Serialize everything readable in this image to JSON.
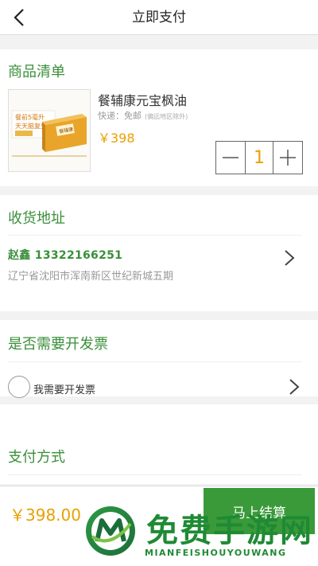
{
  "header": {
    "title": "立即支付",
    "back_icon": "chevron-left-icon"
  },
  "goods": {
    "section_title": "商品清单",
    "product": {
      "name": "餐辅康元宝枫油",
      "shipping": "快递：免邮",
      "shipping_note": "(偏远地区除外)",
      "price": "￥398",
      "image_text_line1": "餐前5毫升",
      "image_text_line2": "天天脑复生",
      "image_box_label": "餐辅康"
    },
    "quantity": "1"
  },
  "address": {
    "section_title": "收货地址",
    "name_phone": "赵鑫 13322166251",
    "detail": "辽宁省沈阳市浑南新区世纪新城五期"
  },
  "invoice": {
    "section_title": "是否需要开发票",
    "option_label": "我需要开发票"
  },
  "payment": {
    "section_title": "支付方式"
  },
  "bottom": {
    "total": "￥398.00",
    "checkout_label": "马上结算"
  },
  "watermark": {
    "title": "免费手游网",
    "subtitle": "MIANFEISHOUYOUWANG"
  },
  "colors": {
    "accent_green": "#3a8f3a",
    "price_orange": "#e8a000",
    "button_green": "#3a9a3a"
  }
}
